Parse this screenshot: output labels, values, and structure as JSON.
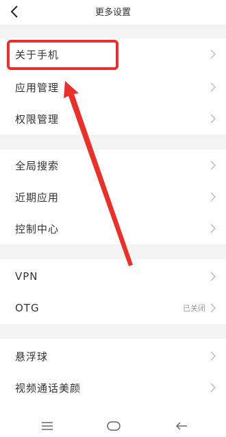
{
  "header": {
    "title": "更多设置"
  },
  "rows": [
    {
      "label": "关于手机"
    },
    {
      "label": "应用管理"
    },
    {
      "label": "权限管理"
    },
    {
      "label": "全局搜索"
    },
    {
      "label": "近期应用"
    },
    {
      "label": "控制中心"
    },
    {
      "label": "VPN"
    },
    {
      "label": "OTG",
      "value": "已关闭"
    },
    {
      "label": "悬浮球"
    },
    {
      "label": "视频通话美颜"
    }
  ],
  "colors": {
    "annotation": "#e8312a",
    "separator": "#f3f3f3"
  },
  "icons": [
    "back-arrow-icon",
    "chevron-right-icon",
    "menu-icon",
    "home-icon",
    "back-icon"
  ]
}
